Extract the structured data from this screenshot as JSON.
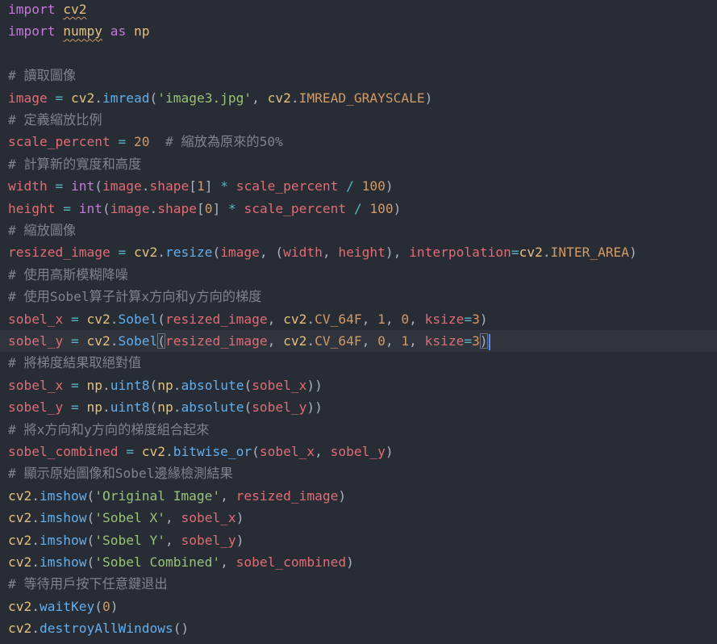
{
  "editor": {
    "language": "python",
    "theme_colors": {
      "background": "#282c34",
      "current_line": "#2f343d",
      "keyword": "#c678dd",
      "variable": "#e06c75",
      "function": "#61afef",
      "number": "#d19a66",
      "string": "#98c379",
      "comment": "#7f848e",
      "operator": "#56b6c2",
      "punctuation": "#abb2bf",
      "module": "#e5c07b",
      "constant": "#d19a66",
      "cursor": "#528bff"
    },
    "lines": [
      [
        [
          "kw",
          "import"
        ],
        [
          "pun",
          " "
        ],
        [
          "mod",
          "cv2",
          1
        ]
      ],
      [
        [
          "kw",
          "import"
        ],
        [
          "pun",
          " "
        ],
        [
          "mod",
          "numpy",
          1
        ],
        [
          "pun",
          " "
        ],
        [
          "kw",
          "as"
        ],
        [
          "pun",
          " "
        ],
        [
          "mod",
          "np"
        ]
      ],
      [],
      [
        [
          "cmt",
          "# 讀取圖像"
        ]
      ],
      [
        [
          "var",
          "image"
        ],
        [
          "pun",
          " "
        ],
        [
          "op",
          "="
        ],
        [
          "pun",
          " "
        ],
        [
          "mod",
          "cv2"
        ],
        [
          "pun",
          "."
        ],
        [
          "fn",
          "imread"
        ],
        [
          "pun",
          "("
        ],
        [
          "str",
          "'image3.jpg'"
        ],
        [
          "pun",
          ", "
        ],
        [
          "mod",
          "cv2"
        ],
        [
          "pun",
          "."
        ],
        [
          "const",
          "IMREAD_GRAYSCALE"
        ],
        [
          "pun",
          ")"
        ]
      ],
      [
        [
          "cmt",
          "# 定義縮放比例"
        ]
      ],
      [
        [
          "var",
          "scale_percent"
        ],
        [
          "pun",
          " "
        ],
        [
          "op",
          "="
        ],
        [
          "pun",
          " "
        ],
        [
          "num",
          "20"
        ],
        [
          "pun",
          "  "
        ],
        [
          "cmt",
          "# 縮放為原來的50%"
        ]
      ],
      [
        [
          "cmt",
          "# 計算新的寬度和高度"
        ]
      ],
      [
        [
          "var",
          "width"
        ],
        [
          "pun",
          " "
        ],
        [
          "op",
          "="
        ],
        [
          "pun",
          " "
        ],
        [
          "kw",
          "int"
        ],
        [
          "pun",
          "("
        ],
        [
          "var",
          "image"
        ],
        [
          "pun",
          "."
        ],
        [
          "var",
          "shape"
        ],
        [
          "pun",
          "["
        ],
        [
          "num",
          "1"
        ],
        [
          "pun",
          "]"
        ],
        [
          "pun",
          " "
        ],
        [
          "op",
          "*"
        ],
        [
          "pun",
          " "
        ],
        [
          "var",
          "scale_percent"
        ],
        [
          "pun",
          " "
        ],
        [
          "op",
          "/"
        ],
        [
          "pun",
          " "
        ],
        [
          "num",
          "100"
        ],
        [
          "pun",
          ")"
        ]
      ],
      [
        [
          "var",
          "height"
        ],
        [
          "pun",
          " "
        ],
        [
          "op",
          "="
        ],
        [
          "pun",
          " "
        ],
        [
          "kw",
          "int"
        ],
        [
          "pun",
          "("
        ],
        [
          "var",
          "image"
        ],
        [
          "pun",
          "."
        ],
        [
          "var",
          "shape"
        ],
        [
          "pun",
          "["
        ],
        [
          "num",
          "0"
        ],
        [
          "pun",
          "]"
        ],
        [
          "pun",
          " "
        ],
        [
          "op",
          "*"
        ],
        [
          "pun",
          " "
        ],
        [
          "var",
          "scale_percent"
        ],
        [
          "pun",
          " "
        ],
        [
          "op",
          "/"
        ],
        [
          "pun",
          " "
        ],
        [
          "num",
          "100"
        ],
        [
          "pun",
          ")"
        ]
      ],
      [
        [
          "cmt",
          "# 縮放圖像"
        ]
      ],
      [
        [
          "var",
          "resized_image"
        ],
        [
          "pun",
          " "
        ],
        [
          "op",
          "="
        ],
        [
          "pun",
          " "
        ],
        [
          "mod",
          "cv2"
        ],
        [
          "pun",
          "."
        ],
        [
          "fn",
          "resize"
        ],
        [
          "pun",
          "("
        ],
        [
          "var",
          "image"
        ],
        [
          "pun",
          ", ("
        ],
        [
          "var",
          "width"
        ],
        [
          "pun",
          ", "
        ],
        [
          "var",
          "height"
        ],
        [
          "pun",
          "), "
        ],
        [
          "var",
          "interpolation"
        ],
        [
          "op",
          "="
        ],
        [
          "mod",
          "cv2"
        ],
        [
          "pun",
          "."
        ],
        [
          "const",
          "INTER_AREA"
        ],
        [
          "pun",
          ")"
        ]
      ],
      [
        [
          "cmt",
          "# 使用高斯模糊降噪"
        ]
      ],
      [
        [
          "cmt",
          "# 使用Sobel算子計算x方向和y方向的梯度"
        ]
      ],
      [
        [
          "var",
          "sobel_x"
        ],
        [
          "pun",
          " "
        ],
        [
          "op",
          "="
        ],
        [
          "pun",
          " "
        ],
        [
          "mod",
          "cv2"
        ],
        [
          "pun",
          "."
        ],
        [
          "fn",
          "Sobel"
        ],
        [
          "pun",
          "("
        ],
        [
          "var",
          "resized_image"
        ],
        [
          "pun",
          ", "
        ],
        [
          "mod",
          "cv2"
        ],
        [
          "pun",
          "."
        ],
        [
          "const",
          "CV_64F"
        ],
        [
          "pun",
          ", "
        ],
        [
          "num",
          "1"
        ],
        [
          "pun",
          ", "
        ],
        [
          "num",
          "0"
        ],
        [
          "pun",
          ", "
        ],
        [
          "var",
          "ksize"
        ],
        [
          "op",
          "="
        ],
        [
          "num",
          "3"
        ],
        [
          "pun",
          ")"
        ]
      ],
      [
        [
          "var",
          "sobel_y"
        ],
        [
          "pun",
          " "
        ],
        [
          "op",
          "="
        ],
        [
          "pun",
          " "
        ],
        [
          "mod",
          "cv2"
        ],
        [
          "pun",
          "."
        ],
        [
          "fn",
          "Sobel"
        ],
        [
          "pun",
          "(",
          2
        ],
        [
          "var",
          "resized_image"
        ],
        [
          "pun",
          ", "
        ],
        [
          "mod",
          "cv2"
        ],
        [
          "pun",
          "."
        ],
        [
          "const",
          "CV_64F"
        ],
        [
          "pun",
          ", "
        ],
        [
          "num",
          "0"
        ],
        [
          "pun",
          ", "
        ],
        [
          "num",
          "1"
        ],
        [
          "pun",
          ", "
        ],
        [
          "var",
          "ksize"
        ],
        [
          "op",
          "="
        ],
        [
          "num",
          "3"
        ],
        [
          "pun",
          ")",
          2
        ]
      ],
      [
        [
          "cmt",
          "# 將梯度結果取絕對值"
        ]
      ],
      [
        [
          "var",
          "sobel_x"
        ],
        [
          "pun",
          " "
        ],
        [
          "op",
          "="
        ],
        [
          "pun",
          " "
        ],
        [
          "mod",
          "np"
        ],
        [
          "pun",
          "."
        ],
        [
          "fn",
          "uint8"
        ],
        [
          "pun",
          "("
        ],
        [
          "mod",
          "np"
        ],
        [
          "pun",
          "."
        ],
        [
          "fn",
          "absolute"
        ],
        [
          "pun",
          "("
        ],
        [
          "var",
          "sobel_x"
        ],
        [
          "pun",
          "))"
        ]
      ],
      [
        [
          "var",
          "sobel_y"
        ],
        [
          "pun",
          " "
        ],
        [
          "op",
          "="
        ],
        [
          "pun",
          " "
        ],
        [
          "mod",
          "np"
        ],
        [
          "pun",
          "."
        ],
        [
          "fn",
          "uint8"
        ],
        [
          "pun",
          "("
        ],
        [
          "mod",
          "np"
        ],
        [
          "pun",
          "."
        ],
        [
          "fn",
          "absolute"
        ],
        [
          "pun",
          "("
        ],
        [
          "var",
          "sobel_y"
        ],
        [
          "pun",
          "))"
        ]
      ],
      [
        [
          "cmt",
          "# 將x方向和y方向的梯度組合起來"
        ]
      ],
      [
        [
          "var",
          "sobel_combined"
        ],
        [
          "pun",
          " "
        ],
        [
          "op",
          "="
        ],
        [
          "pun",
          " "
        ],
        [
          "mod",
          "cv2"
        ],
        [
          "pun",
          "."
        ],
        [
          "fn",
          "bitwise_or"
        ],
        [
          "pun",
          "("
        ],
        [
          "var",
          "sobel_x"
        ],
        [
          "pun",
          ", "
        ],
        [
          "var",
          "sobel_y"
        ],
        [
          "pun",
          ")"
        ]
      ],
      [
        [
          "cmt",
          "# 顯示原始圖像和Sobel邊緣檢測結果"
        ]
      ],
      [
        [
          "mod",
          "cv2"
        ],
        [
          "pun",
          "."
        ],
        [
          "fn",
          "imshow"
        ],
        [
          "pun",
          "("
        ],
        [
          "str",
          "'Original Image'"
        ],
        [
          "pun",
          ", "
        ],
        [
          "var",
          "resized_image"
        ],
        [
          "pun",
          ")"
        ]
      ],
      [
        [
          "mod",
          "cv2"
        ],
        [
          "pun",
          "."
        ],
        [
          "fn",
          "imshow"
        ],
        [
          "pun",
          "("
        ],
        [
          "str",
          "'Sobel X'"
        ],
        [
          "pun",
          ", "
        ],
        [
          "var",
          "sobel_x"
        ],
        [
          "pun",
          ")"
        ]
      ],
      [
        [
          "mod",
          "cv2"
        ],
        [
          "pun",
          "."
        ],
        [
          "fn",
          "imshow"
        ],
        [
          "pun",
          "("
        ],
        [
          "str",
          "'Sobel Y'"
        ],
        [
          "pun",
          ", "
        ],
        [
          "var",
          "sobel_y"
        ],
        [
          "pun",
          ")"
        ]
      ],
      [
        [
          "mod",
          "cv2"
        ],
        [
          "pun",
          "."
        ],
        [
          "fn",
          "imshow"
        ],
        [
          "pun",
          "("
        ],
        [
          "str",
          "'Sobel Combined'"
        ],
        [
          "pun",
          ", "
        ],
        [
          "var",
          "sobel_combined"
        ],
        [
          "pun",
          ")"
        ]
      ],
      [
        [
          "cmt",
          "# 等待用戶按下任意鍵退出"
        ]
      ],
      [
        [
          "mod",
          "cv2"
        ],
        [
          "pun",
          "."
        ],
        [
          "fn",
          "waitKey"
        ],
        [
          "pun",
          "("
        ],
        [
          "num",
          "0"
        ],
        [
          "pun",
          ")"
        ]
      ],
      [
        [
          "mod",
          "cv2"
        ],
        [
          "pun",
          "."
        ],
        [
          "fn",
          "destroyAllWindows"
        ],
        [
          "pun",
          "()"
        ]
      ]
    ]
  }
}
